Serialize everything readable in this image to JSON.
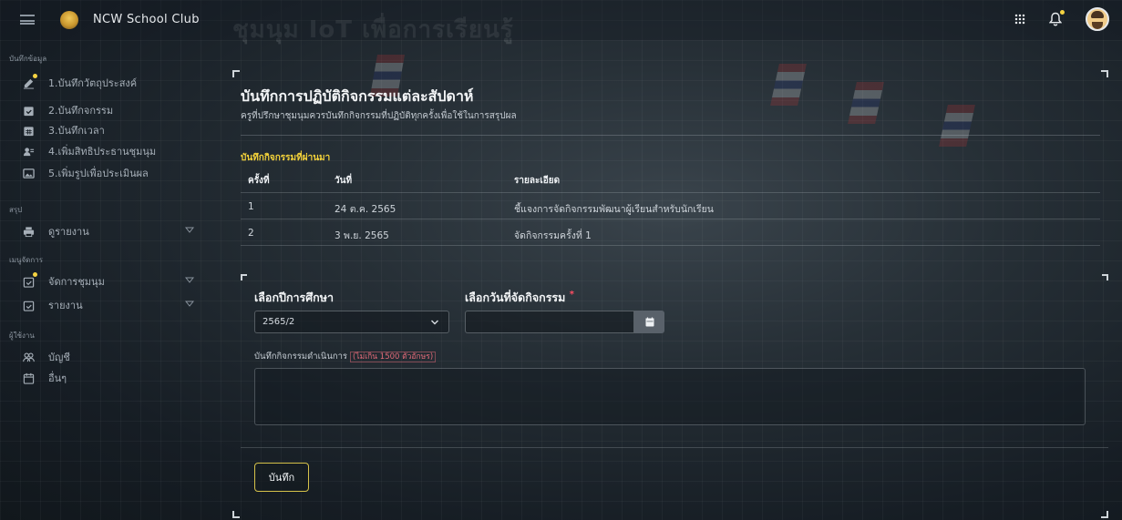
{
  "app": {
    "brand": "NCW School Club"
  },
  "background": {
    "banner_text": "ชุมนุม IoT เพื่อการเรียนรู้"
  },
  "sidebar": {
    "sections": [
      {
        "title": "บันทึกข้อมูล",
        "items": [
          {
            "label": "1.บันทึกวัตถุประสงค์",
            "icon": "edit-icon",
            "dot": true
          },
          {
            "label": "2.บันทึกจกรรม",
            "icon": "calendar-check-icon"
          },
          {
            "label": "3.บันทึกเวลา",
            "icon": "calendar-grid-icon"
          },
          {
            "label": "4.เพิ่มสิทธิประธานชุมนุม",
            "icon": "user-card-icon"
          },
          {
            "label": "5.เพิ่มรูปเพื่อประเมินผล",
            "icon": "image-icon"
          }
        ]
      },
      {
        "title": "สรุป",
        "items": [
          {
            "label": "ดูรายงาน",
            "icon": "printer-icon",
            "expandable": true
          }
        ]
      },
      {
        "title": "เมนูจัดการ",
        "items": [
          {
            "label": "จัดการชุมนุม",
            "icon": "calendar-check-icon",
            "dot": true,
            "expandable": true
          },
          {
            "label": "รายงาน",
            "icon": "calendar-check-icon",
            "expandable": true
          }
        ]
      },
      {
        "title": "ผู้ใช้งาน",
        "items": [
          {
            "label": "บัญชี",
            "icon": "users-icon"
          },
          {
            "label": "อื่นๆ",
            "icon": "calendar-outline-icon"
          }
        ]
      }
    ]
  },
  "main": {
    "title": "บันทึกการปฏิบัติกิจกรรมแต่ละสัปดาห์",
    "subtitle": "ครูที่ปรึกษาชุมนุมควรบันทึกกิจกรรมที่ปฏิบัติทุกครั้งเพื่อใช้ในการสรุปผล",
    "past_title": "บันทึกกิจกรรมที่ผ่านมา",
    "table": {
      "headers": [
        "ครั้งที่",
        "วันที่",
        "รายละเอียด"
      ],
      "rows": [
        [
          "1",
          "24 ต.ค. 2565",
          "ชี้แจงการจัดกิจกรรมพัฒนาผู้เรียนสำหรับนักเรียน"
        ],
        [
          "2",
          "3 พ.ย. 2565",
          "จัดกิจกรรมครั้งที่ 1"
        ]
      ]
    },
    "form": {
      "year_label": "เลือกปีการศึกษา",
      "year_value": "2565/2",
      "date_label": "เลือกวันที่จัดกิจกรรม",
      "required_mark": "*",
      "date_value": "",
      "note_label": "บันทึกกิจกรรมดำเนินการ",
      "note_limit": "(ไม่เกิน 1500 ตัวอักษร)",
      "note_value": "",
      "save_label": "บันทึก"
    }
  },
  "colors": {
    "accent_yellow": "#f4d23a",
    "required_red": "#ff4d63",
    "button_border": "#d6c24a"
  }
}
